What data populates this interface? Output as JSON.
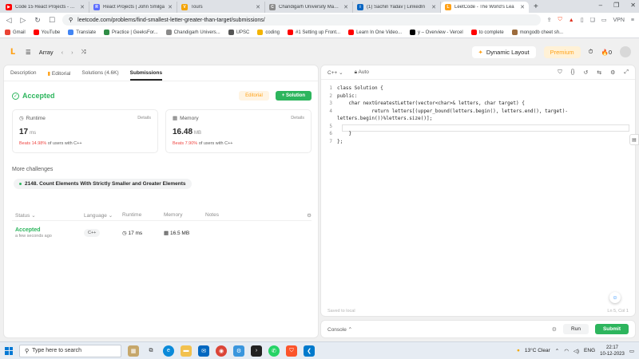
{
  "browser": {
    "tabs": [
      {
        "title": "Code 15 React Projects - Compl",
        "fav": "youtube",
        "color": "#ff0000",
        "active": false
      },
      {
        "title": "React Projects | John Smilga",
        "fav": "R",
        "color": "#5b6cff",
        "active": false
      },
      {
        "title": "Tours",
        "fav": "V",
        "color": "#f4a300",
        "active": false
      },
      {
        "title": "Chandigarh University Managem",
        "fav": "C",
        "color": "#8a8a8a",
        "active": false
      },
      {
        "title": "(1) Sachin Yadav | LinkedIn",
        "fav": "in",
        "color": "#0a66c2",
        "active": false
      },
      {
        "title": "LeetCode - The World's Lea",
        "fav": "L",
        "color": "#ffa116",
        "active": true
      }
    ],
    "url": "leetcode.com/problems/find-smallest-letter-greater-than-target/submissions/",
    "vpn_label": "VPN",
    "bookmarks": [
      {
        "label": "Gmail",
        "color": "#ea4335"
      },
      {
        "label": "YouTube",
        "color": "#ff0000"
      },
      {
        "label": "Translate",
        "color": "#4285f4"
      },
      {
        "label": "Practice | GeeksFor...",
        "color": "#2f8d46"
      },
      {
        "label": "Chandigarh Univers...",
        "color": "#8a8a8a"
      },
      {
        "label": "UPSC",
        "color": "#555555"
      },
      {
        "label": "coding",
        "color": "#f4b400"
      },
      {
        "label": "#1 Setting up Front...",
        "color": "#ff0000"
      },
      {
        "label": "Learn In One Video...",
        "color": "#ff0000"
      },
      {
        "label": "y – Overview - Vercel",
        "color": "#000000"
      },
      {
        "label": "to complete",
        "color": "#ff0000"
      },
      {
        "label": "mongodb cheet sh...",
        "color": "#9c6b3c"
      }
    ]
  },
  "lcnav": {
    "problem_list": "Array",
    "dynamic_layout": "Dynamic Layout",
    "premium": "Premium",
    "streak": "0"
  },
  "left": {
    "tabs": [
      "Description",
      "Editorial",
      "Solutions (4.6K)",
      "Submissions"
    ],
    "status": "Accepted",
    "editorial_btn": "Editorial",
    "solution_btn": "+ Solution",
    "runtime": {
      "label": "Runtime",
      "details": "Details",
      "value": "17",
      "unit": "ms",
      "beats": "Beats 14.98%",
      "suffix": "of users with C++"
    },
    "memory": {
      "label": "Memory",
      "details": "Details",
      "value": "16.48",
      "unit": "MB",
      "beats": "Beats 7.90%",
      "suffix": "of users with C++"
    },
    "more_challenges": "More challenges",
    "challenge": "2148. Count Elements With Strictly Smaller and Greater Elements",
    "table": {
      "headers": {
        "status": "Status",
        "language": "Language",
        "runtime": "Runtime",
        "memory": "Memory",
        "notes": "Notes"
      },
      "rows": [
        {
          "status": "Accepted",
          "time": "a few seconds ago",
          "language": "C++",
          "runtime": "17 ms",
          "memory": "16.5 MB"
        }
      ]
    }
  },
  "code": {
    "language": "C++",
    "auto": "Auto",
    "lines": [
      "class Solution {",
      "public:",
      "    char nextGreatestLetter(vector<char>& letters, char target) {",
      "            return letters[(upper_bound(letters.begin(), letters.end(), target)- letters.begin())%letters.size()];",
      "",
      "    }",
      "};"
    ],
    "line_numbers": [
      "1",
      "2",
      "3",
      "4",
      "5",
      "6",
      "7"
    ],
    "saved": "Saved to local",
    "position": "Ln 5, Col 1"
  },
  "console": {
    "label": "Console",
    "run": "Run",
    "submit": "Submit"
  },
  "taskbar": {
    "search_placeholder": "Type here to search",
    "weather": "13°C  Clear",
    "lang": "ENG",
    "time": "22:17",
    "date": "10-12-2023"
  }
}
